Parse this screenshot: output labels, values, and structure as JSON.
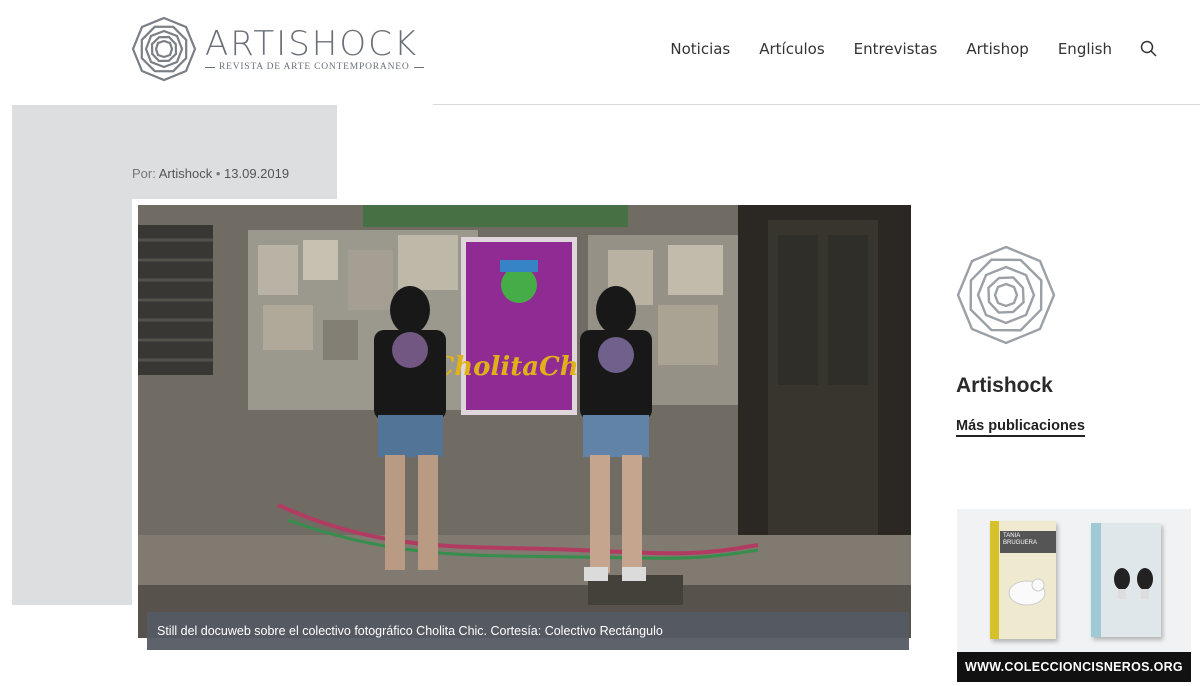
{
  "header": {
    "logo_title": "ARTISHOCK",
    "logo_subtitle": "REVISTA DE ARTE CONTEMPORANEO",
    "nav": [
      {
        "label": "Noticias"
      },
      {
        "label": "Artículos"
      },
      {
        "label": "Entrevistas"
      },
      {
        "label": "Artishop"
      },
      {
        "label": "English"
      }
    ],
    "search_icon": "search-icon"
  },
  "article": {
    "byline_prefix": "Por:",
    "author": "Artishock",
    "separator": "•",
    "date": "13.09.2019",
    "image_caption": "Still del docuweb sobre el colectivo fotográfico Cholita Chic. Cortesía: Colectivo Rectángulo",
    "poster_text": "CholitaChic"
  },
  "sidebar": {
    "author_name": "Artishock",
    "more_link": "Más publicaciones",
    "ad_url": "WWW.COLECCIONCISNEROS.ORG",
    "ad_book1_text": "TANIA BRUGUERA"
  },
  "colors": {
    "logo_gray": "#6b7078",
    "panel_gray": "#dcdee0",
    "caption_bg": "#555a62"
  }
}
